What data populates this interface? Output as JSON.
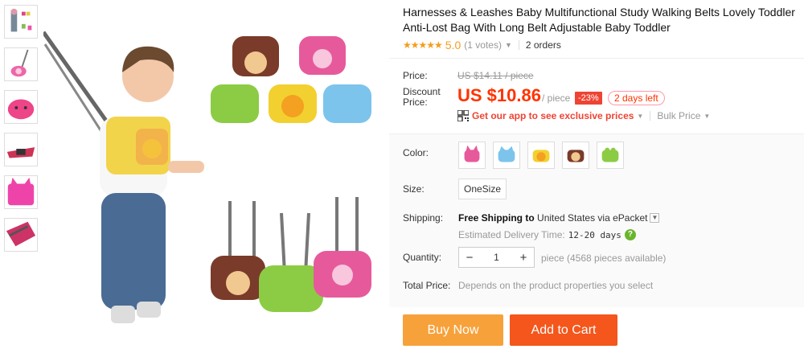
{
  "product": {
    "title": "Harnesses & Leashes Baby Multifunctional Study Walking Belts Lovely Toddler Anti-Lost Bag With Long Belt Adjustable Baby Toddler",
    "stars": "★★★★★",
    "score": "5.0",
    "votes": "(1 votes)",
    "orders": "2 orders"
  },
  "price": {
    "label": "Price:",
    "original": "US $14.11 / piece",
    "discount_label_1": "Discount",
    "discount_label_2": "Price:",
    "current": "US $10.86",
    "unit": "/ piece",
    "percent_off": "-23%",
    "time_left": "2 days left",
    "app_promo": "Get our app to see exclusive prices",
    "bulk": "Bulk Price"
  },
  "options": {
    "color_label": "Color:",
    "colors": [
      "pink bunny",
      "blue elephant",
      "yellow lion",
      "brown monkey",
      "green frog"
    ],
    "size_label": "Size:",
    "size_value": "OneSize"
  },
  "shipping": {
    "label": "Shipping:",
    "free": "Free Shipping",
    "to": "to",
    "destination": "United States",
    "via": "via",
    "carrier": "ePacket",
    "delivery_label": "Estimated Delivery Time:",
    "delivery_value": "12-20 days"
  },
  "quantity": {
    "label": "Quantity:",
    "value": "1",
    "available": "piece (4568 pieces available)"
  },
  "total": {
    "label": "Total Price:",
    "text": "Depends on the product properties you select"
  },
  "actions": {
    "buy_now": "Buy Now",
    "add_to_cart": "Add to Cart"
  },
  "colors": {
    "accent_red": "#f30",
    "buy_orange": "#f7a13a",
    "cart_orange": "#f4561c",
    "star": "#f79c1c"
  }
}
